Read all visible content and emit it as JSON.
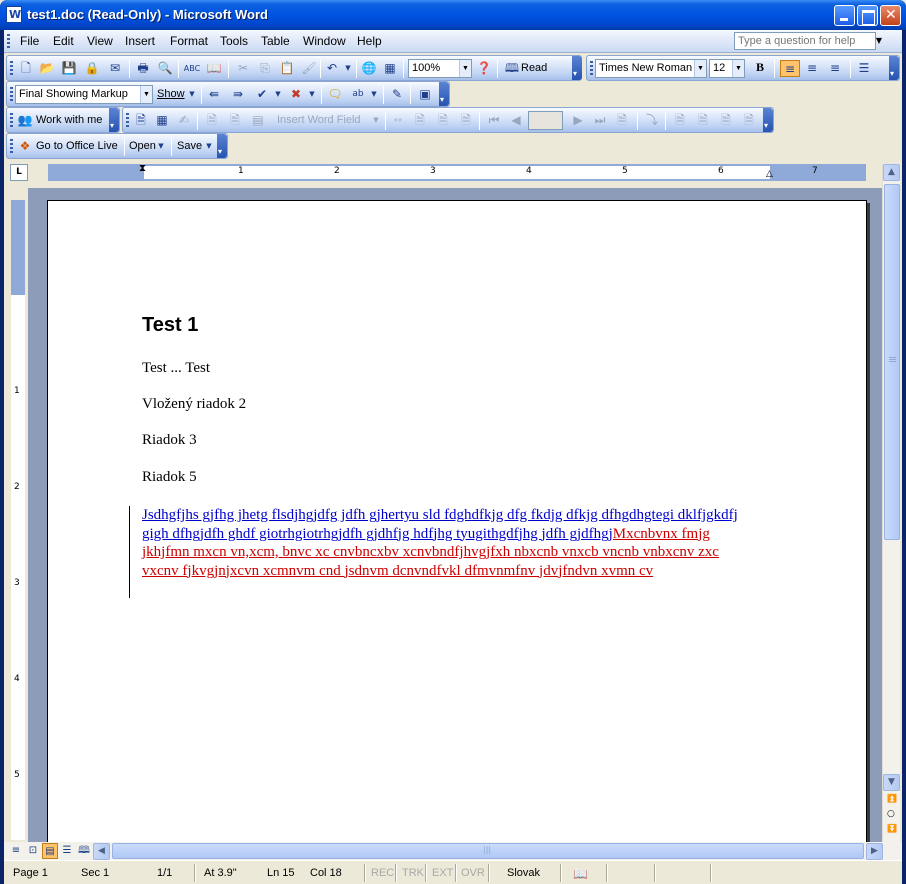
{
  "window": {
    "title": "test1.doc (Read-Only) - Microsoft Word"
  },
  "menubar": {
    "items": [
      "File",
      "Edit",
      "View",
      "Insert",
      "Format",
      "Tools",
      "Table",
      "Window",
      "Help"
    ],
    "ask_placeholder": "Type a question for help"
  },
  "standard_toolbar": {
    "zoom": "100%",
    "read_label": "Read"
  },
  "formatting_toolbar": {
    "font": "Times New Roman",
    "size": "12",
    "bold_label": "B"
  },
  "reviewing_toolbar": {
    "display": "Final Showing Markup",
    "show_label": "Show"
  },
  "collab_toolbar": {
    "work_with_me": "Work with me"
  },
  "mailmerge_toolbar": {
    "insert_word_field": "Insert Word Field"
  },
  "office_live_toolbar": {
    "go_to": "Go to Office Live",
    "open": "Open",
    "save": "Save"
  },
  "ruler": {
    "corner": "L",
    "h_numbers": [
      "1",
      "2",
      "3",
      "4",
      "5",
      "6",
      "7"
    ],
    "v_numbers": [
      "1",
      "2",
      "3",
      "4",
      "5"
    ]
  },
  "document": {
    "heading": "Test 1",
    "paragraphs": [
      "Test ... Test",
      "Vložený riadok 2",
      "Riadok 3",
      "Riadok 5"
    ],
    "tracked_blue": "Jsdhgfjhs gjfhg jhetg flsdjhgjdfg jdfh gjhertyu sld fdghdfkjg dfg fkdjg dfkjg dfhgdhgtegi dklfjgkdfj gigh dfhgjdfh ghdf giotrhgiotrhgjdfh gjdhfjg hdfjhg tyugithgdfjhg jdfh gjdfhgj",
    "tracked_red": "Mxcnbvnx fmjg jkhjfmn mxcn vn,xcm, bnvc xc cnvbncxbv xcnvbndfjhvgjfxh nbxcnb vnxcb vncnb vnbxcnv zxc vxcnv fjkvgjnjxcvn xcmnvm cnd jsdnvm dcnvndfvkl dfmvnmfnv jdvjfndvn xvmn cv",
    "blue_color": "#0000cc",
    "red_color": "#cc0000"
  },
  "statusbar": {
    "page": "Page 1",
    "sec": "Sec 1",
    "pages": "1/1",
    "at": "At 3.9\"",
    "ln": "Ln 15",
    "col": "Col 18",
    "rec": "REC",
    "trk": "TRK",
    "ext": "EXT",
    "ovr": "OVR",
    "language": "Slovak"
  }
}
